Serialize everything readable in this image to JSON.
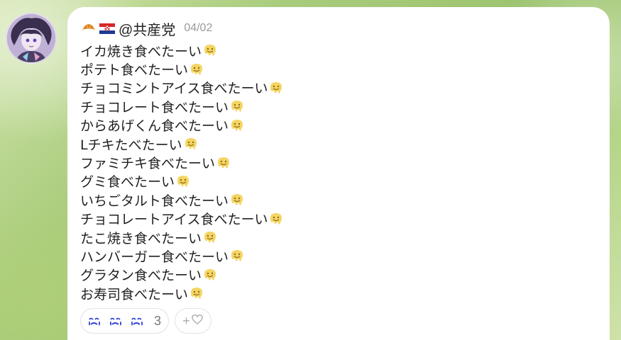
{
  "post": {
    "author_emojis": [
      "croissant-icon",
      "croatia-flag-icon"
    ],
    "username": "@共産党",
    "date": "04/02",
    "lines": [
      "イカ焼き食べたーい",
      "ポテト食べたーい",
      "チョコミントアイス食べたーい",
      "チョコレート食べたーい",
      "からあげくん食べたーい",
      "Lチキたべたーい",
      "ファミチキ食べたーい",
      "グミ食べたーい",
      "いちごタルト食べたーい",
      "チョコレートアイス食べたーい",
      "たこ焼き食べたーい",
      "ハンバーガー食べたーい",
      "グラタン食べたーい",
      "お寿司食べたーい"
    ],
    "line_suffix_icon": "melting-face-icon",
    "reactions": {
      "icon": "crying-face-icon",
      "count": "3"
    },
    "add_reaction_label": "+"
  },
  "colors": {
    "card_bg": "#ffffff",
    "date_text": "#9a9a9a",
    "reaction_blue": "#2d3fd4",
    "melting_face_yellow": "#f5d563"
  }
}
